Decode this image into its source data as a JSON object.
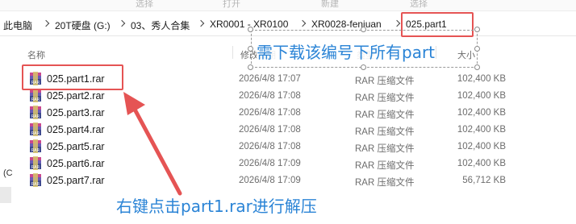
{
  "ribbon": {
    "items": [
      "选择",
      "打开",
      "新建",
      "选择"
    ]
  },
  "breadcrumb": [
    "此电脑",
    "20T硬盘 (G:)",
    "03、秀人合集",
    "XR0001 - XR0100",
    "XR0028-fenjuan",
    "025.part1"
  ],
  "columns": {
    "name": "名称",
    "date": "修改日期",
    "type": "类型",
    "size": "大小"
  },
  "files": [
    {
      "name": "025.part1.rar",
      "date": "2026/4/8 17:07",
      "type": "RAR 压缩文件",
      "size": "102,400 KB"
    },
    {
      "name": "025.part2.rar",
      "date": "2026/4/8 17:08",
      "type": "RAR 压缩文件",
      "size": "102,400 KB"
    },
    {
      "name": "025.part3.rar",
      "date": "2026/4/8 17:08",
      "type": "RAR 压缩文件",
      "size": "102,400 KB"
    },
    {
      "name": "025.part4.rar",
      "date": "2026/4/8 17:08",
      "type": "RAR 压缩文件",
      "size": "102,400 KB"
    },
    {
      "name": "025.part5.rar",
      "date": "2026/4/8 17:08",
      "type": "RAR 压缩文件",
      "size": "102,400 KB"
    },
    {
      "name": "025.part6.rar",
      "date": "2026/4/8 17:09",
      "type": "RAR 压缩文件",
      "size": "102,400 KB"
    },
    {
      "name": "025.part7.rar",
      "date": "2026/4/8 17:09",
      "type": "RAR 压缩文件",
      "size": "56,712 KB"
    }
  ],
  "left_pane": {
    "fragment": "(C"
  },
  "annotations": {
    "top_note": "需下载该编号下所有part",
    "bottom_note": "右键点击part1.rar进行解压",
    "colors": {
      "box": "#e55454",
      "text": "#2b84d6",
      "arrow": "#e55454"
    }
  },
  "icons": {
    "file": "rar-archive-icon",
    "separator": "chevron-right-icon"
  }
}
